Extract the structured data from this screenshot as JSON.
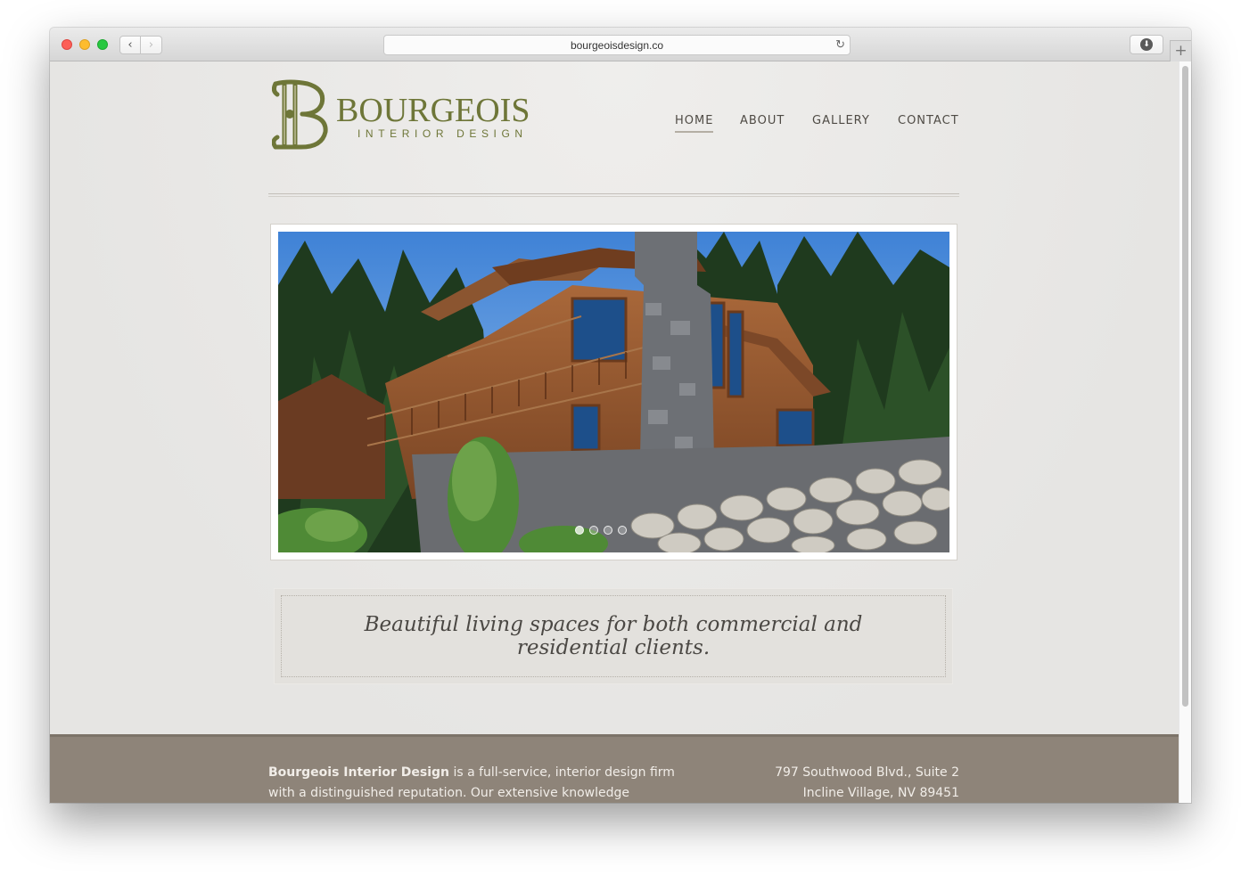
{
  "browser": {
    "url": "bourgeoisdesign.co",
    "back_icon": "‹",
    "forward_icon": "›",
    "reload_icon": "↻",
    "download_icon": "⬇",
    "new_tab_icon": "+"
  },
  "brand": {
    "name": "BOURGEOIS",
    "tagline": "INTERIOR DESIGN",
    "monogram": "B",
    "color": "#6e7638"
  },
  "nav": {
    "items": [
      {
        "label": "HOME",
        "active": true
      },
      {
        "label": "ABOUT",
        "active": false
      },
      {
        "label": "GALLERY",
        "active": false
      },
      {
        "label": "CONTACT",
        "active": false
      }
    ]
  },
  "slider": {
    "slides": 4,
    "active_index": 0
  },
  "tagline_box": {
    "text": "Beautiful living spaces for both commercial and residential clients."
  },
  "footer": {
    "company": "Bourgeois Interior Design",
    "about_rest": " is a full-service, interior design firm with a distinguished reputation. Our extensive knowledge",
    "address_line1": "797 Southwood Blvd., Suite 2",
    "address_line2": "Incline Village, NV 89451",
    "color": "#8e8479"
  }
}
